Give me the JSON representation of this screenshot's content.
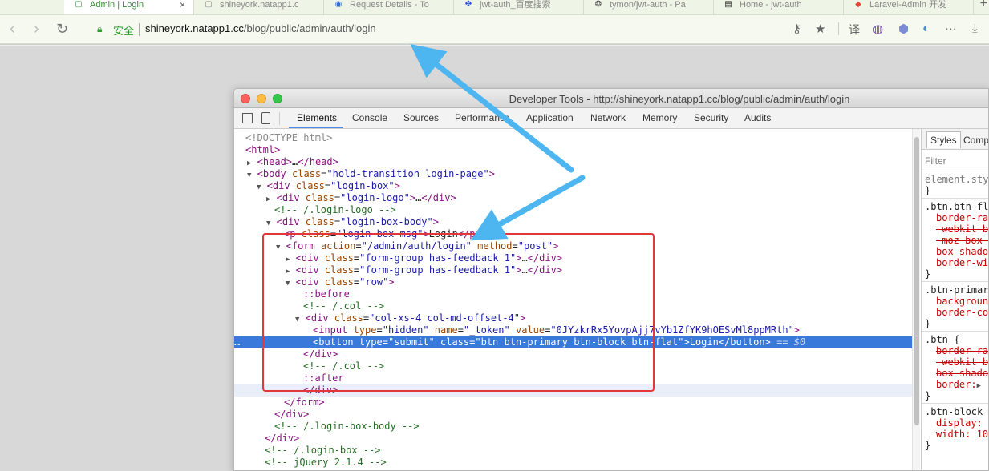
{
  "browser": {
    "tabs": [
      {
        "title": "Admin | Login",
        "icon": "page-icon",
        "active": true
      },
      {
        "title": "shineyork.natapp1.c",
        "icon": "page-icon",
        "active": false
      },
      {
        "title": "Request Details - To",
        "icon": "globe-icon",
        "active": false
      },
      {
        "title": "jwt-auth_百度搜索",
        "icon": "paw-icon",
        "active": false
      },
      {
        "title": "tymon/jwt-auth - Pa",
        "icon": "package-icon",
        "active": false
      },
      {
        "title": "Home - jwt-auth",
        "icon": "doc-icon",
        "active": false
      },
      {
        "title": "Laravel-Admin 开发",
        "icon": "laravel-icon",
        "active": false
      }
    ],
    "address": {
      "secure_label": "安全",
      "host": "shineyork.natapp1.cc",
      "path": "/blog/public/admin/auth/login"
    },
    "translate_label": "译"
  },
  "devtools": {
    "title": "Developer Tools - http://shineyork.natapp1.cc/blog/public/admin/auth/login",
    "tabs": [
      "Elements",
      "Console",
      "Sources",
      "Performance",
      "Application",
      "Network",
      "Memory",
      "Security",
      "Audits"
    ],
    "active_tab": "Elements",
    "styles_tabs": [
      "Styles",
      "Computed"
    ],
    "filter_placeholder": "Filter",
    "dom": {
      "doctype": "<!DOCTYPE html>",
      "html": "html",
      "head": "head",
      "body_class": "hold-transition login-page",
      "login_box_class": "login-box",
      "login_logo_class": "login-logo",
      "comment_login_logo": "<!-- /.login-logo -->",
      "login_box_body_class": "login-box-body",
      "login_box_msg_class": "login-box-msg",
      "login_box_msg_text": "Login",
      "form_action": "/admin/auth/login",
      "form_method": "post",
      "form_group_class": "form-group has-feedback 1",
      "row_class": "row",
      "pseudo_before": "::before",
      "comment_col": "<!-- /.col -->",
      "col_class": "col-xs-4 col-md-offset-4",
      "input_type": "hidden",
      "input_name": "_token",
      "input_value": "0JYzkrRx5YovpAjj7vYb1ZfYK9hOESvMl8ppMRth",
      "button_type": "submit",
      "button_class": "btn btn-primary btn-block btn-flat",
      "button_text": "Login",
      "selected_marker": "== $0",
      "pseudo_after": "::after",
      "comment_login_box_body": "<!-- /.login-box-body -->",
      "comment_login_box": "<!-- /.login-box -->",
      "comment_jquery": "<!-- jQuery 2.1.4 -->"
    },
    "styles": {
      "element_style": "element.style",
      "rules": [
        {
          "selector": ".btn.btn-fl",
          "props": [
            {
              "text": "border-ra",
              "strike": false
            },
            {
              "text": "-webkit-b",
              "strike": true
            },
            {
              "text": "-moz-box-",
              "strike": true
            },
            {
              "text": "box-shado",
              "strike": false
            },
            {
              "text": "border-wi",
              "strike": false
            }
          ]
        },
        {
          "selector": ".btn-primar",
          "props": [
            {
              "text": "backgroun",
              "strike": false
            },
            {
              "text": "border-co",
              "strike": false
            }
          ]
        },
        {
          "selector": ".btn {",
          "props": [
            {
              "text": "border-ra",
              "strike": true
            },
            {
              "text": "-webkit-b",
              "strike": true
            },
            {
              "text": "box-shado",
              "strike": true
            },
            {
              "text": "border:",
              "strike": false
            }
          ]
        },
        {
          "selector": ".btn-block",
          "props": [
            {
              "text": "display:",
              "strike": false
            },
            {
              "text": "width: 10",
              "strike": false
            }
          ]
        }
      ]
    }
  },
  "colors": {
    "annotation_red": "#e1373b",
    "annotation_arrow": "#4db6f0",
    "selection_blue": "#3879d9",
    "secure_green": "#2a9a2a"
  }
}
